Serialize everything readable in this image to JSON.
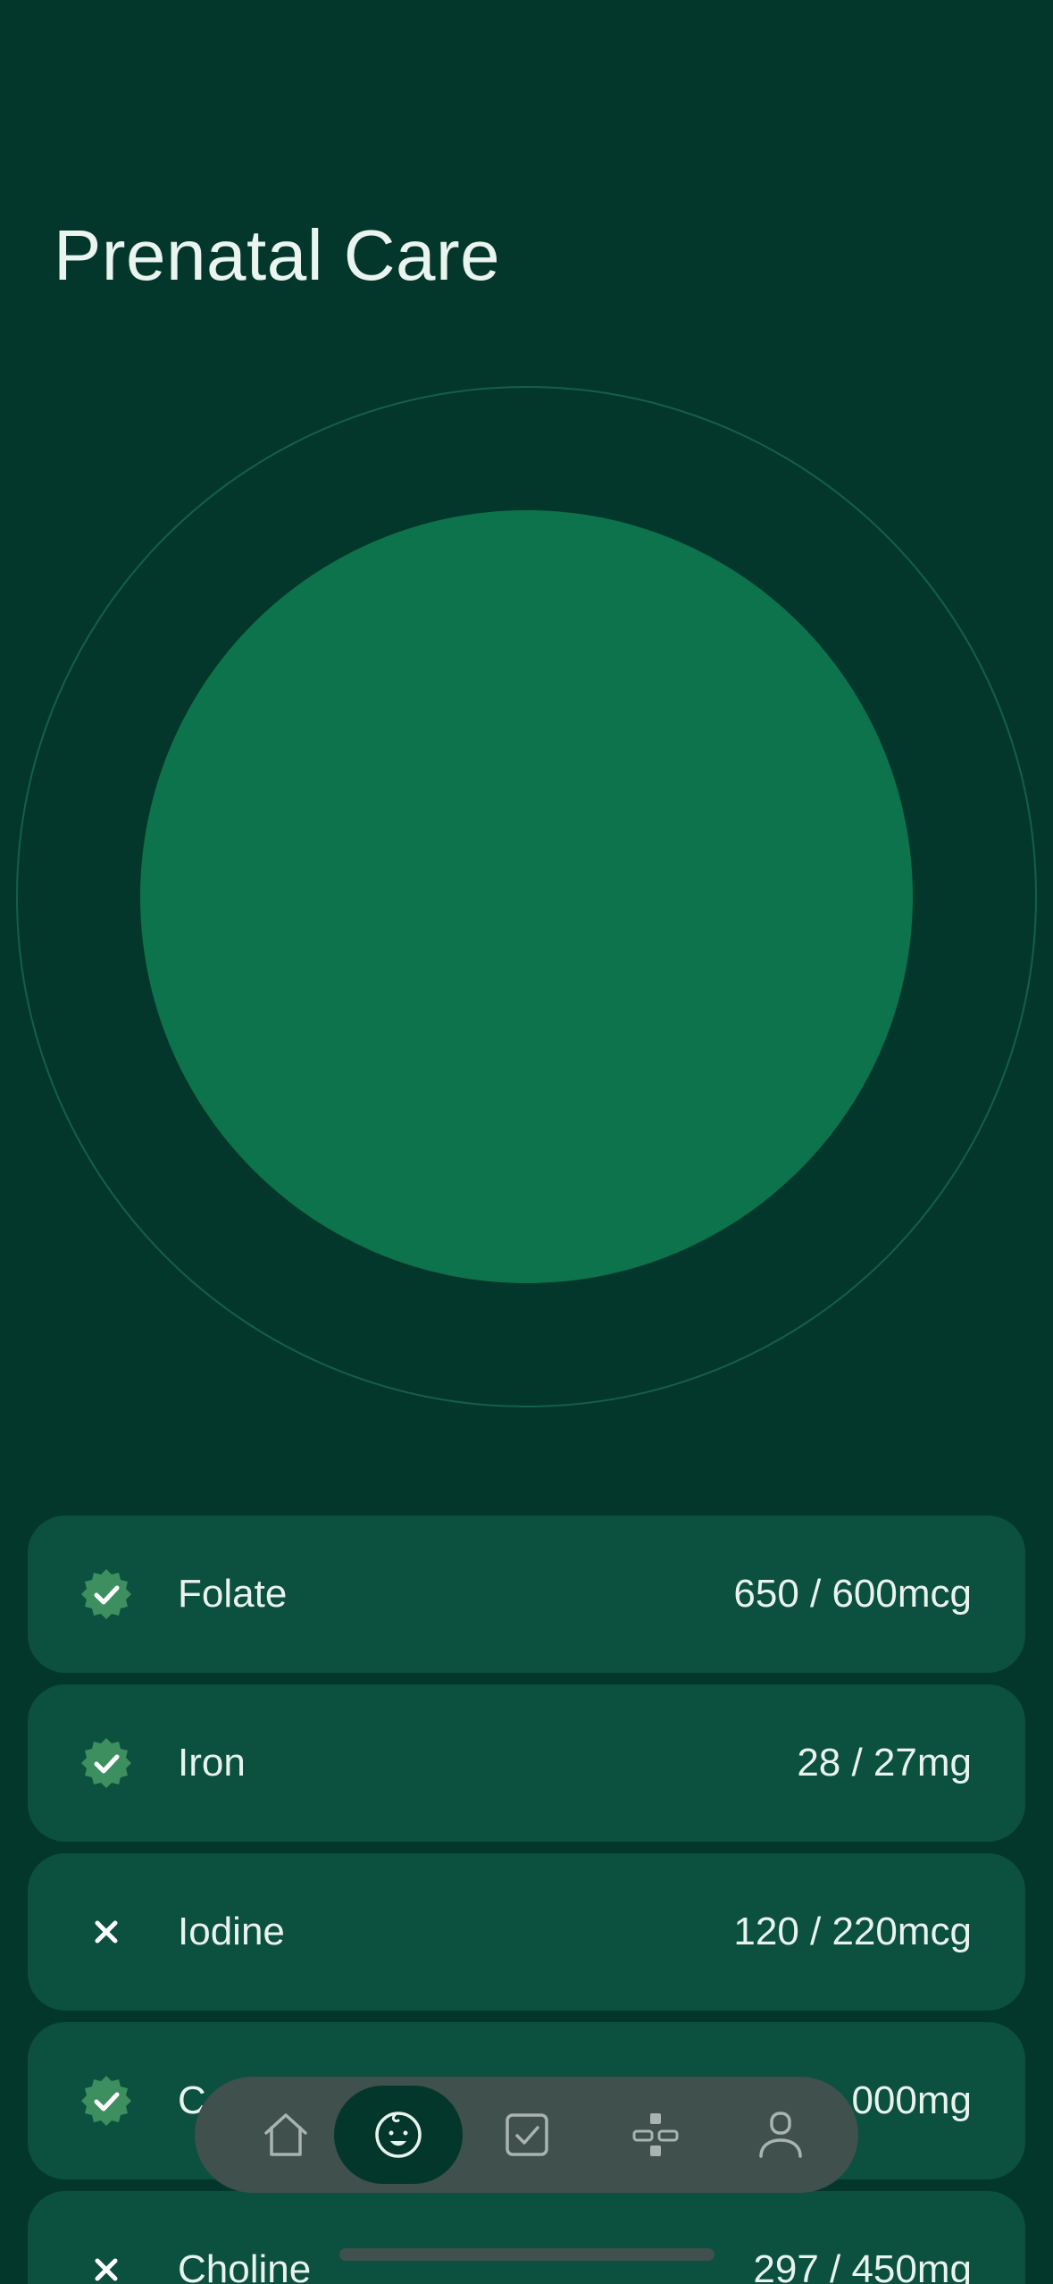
{
  "header": {
    "title": "Prenatal Care"
  },
  "nutrients": [
    {
      "label": "Folate",
      "value": "650 / 600mcg",
      "status": "met",
      "status_icon": "check-badge-icon"
    },
    {
      "label": "Iron",
      "value": "28 / 27mg",
      "status": "met",
      "status_icon": "check-badge-icon"
    },
    {
      "label": "Iodine",
      "value": "120 / 220mcg",
      "status": "unmet",
      "status_icon": "x-icon"
    },
    {
      "label": "C",
      "value": "000mg",
      "status": "met",
      "status_icon": "check-badge-icon"
    },
    {
      "label": "Choline",
      "value": "297 / 450mg",
      "status": "unmet",
      "status_icon": "x-icon"
    }
  ],
  "bottom_nav": {
    "items": [
      {
        "name": "home",
        "icon": "home-icon",
        "active": false
      },
      {
        "name": "baby",
        "icon": "baby-face-icon",
        "active": true
      },
      {
        "name": "tasks",
        "icon": "checkbox-icon",
        "active": false
      },
      {
        "name": "network",
        "icon": "network-icon",
        "active": false
      },
      {
        "name": "profile",
        "icon": "person-icon",
        "active": false
      }
    ]
  },
  "colors": {
    "background": "#04372b",
    "progress_circle": "#0c734c",
    "ring": "#13604a",
    "card": "#0c503f",
    "check_badge": "#3d8f5f",
    "nav_bar": "#3f504d"
  }
}
